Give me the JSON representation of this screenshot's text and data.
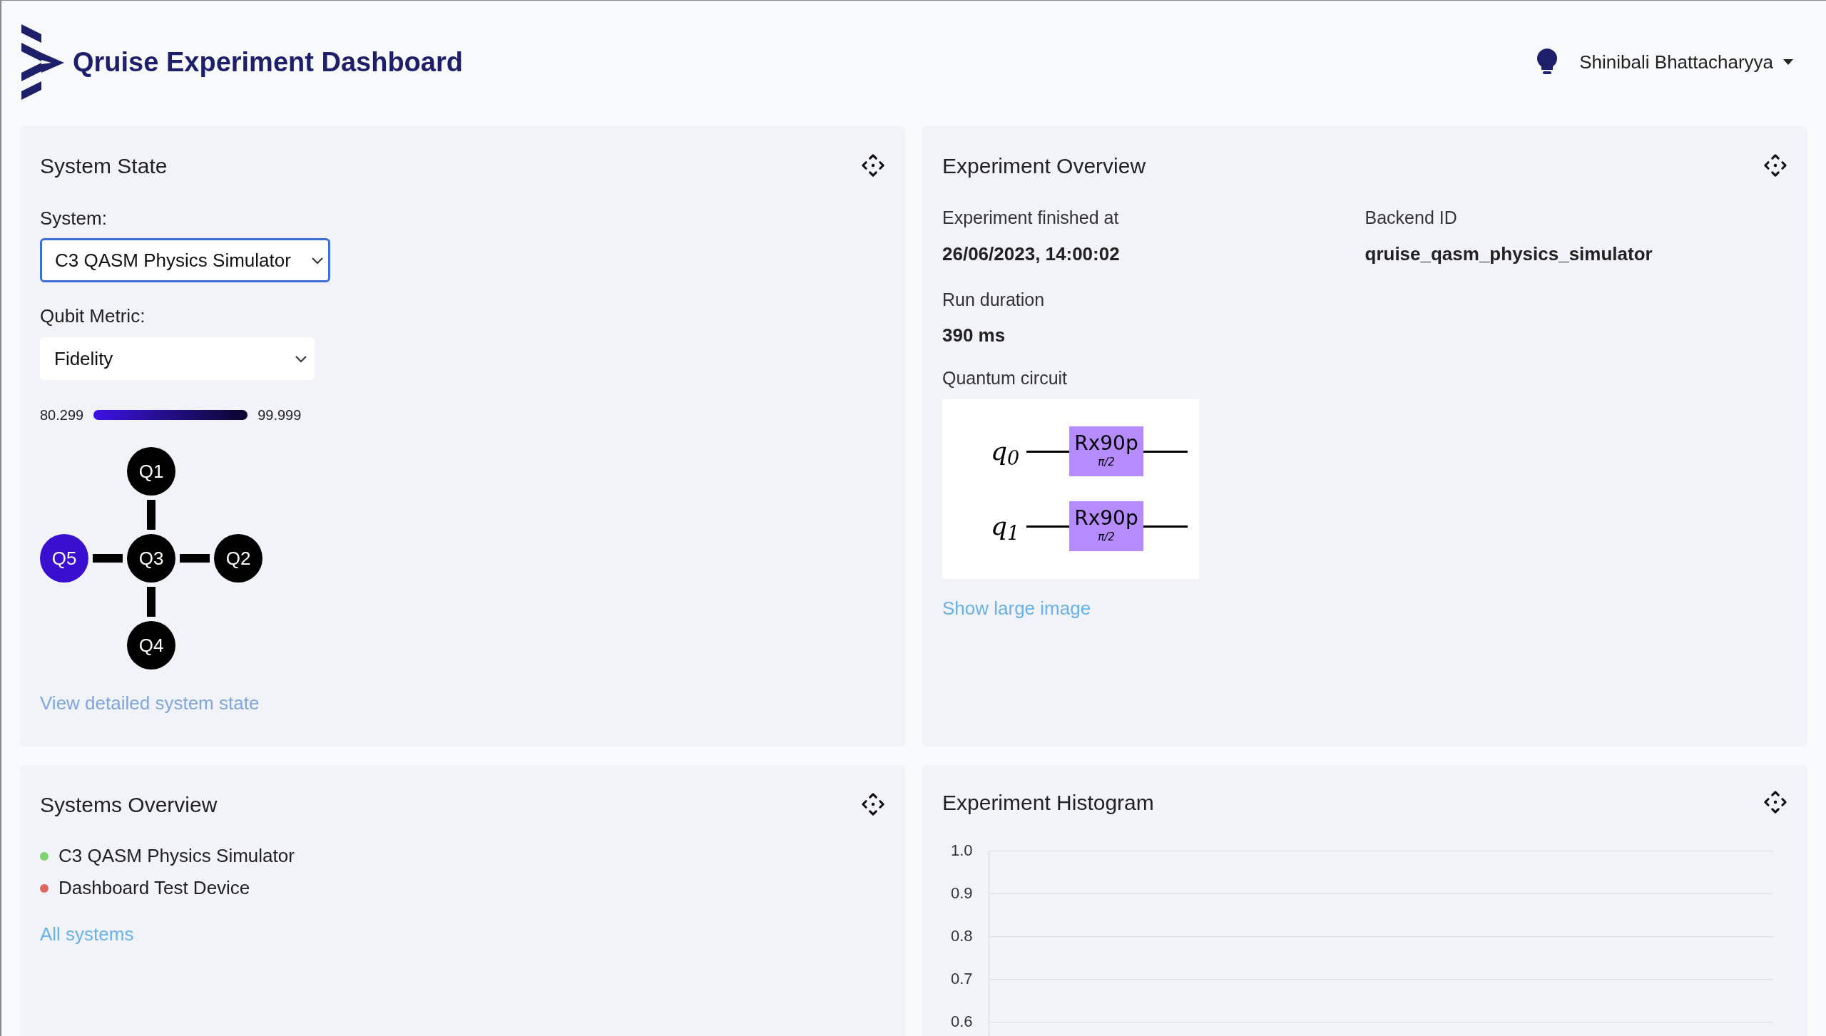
{
  "header": {
    "title": "Qruise Experiment Dashboard",
    "user": "Shinibali Bhattacharyya"
  },
  "system_state": {
    "title": "System State",
    "system_label": "System:",
    "system_value": "C3 QASM Physics Simulator",
    "system_focused": true,
    "metric_label": "Qubit Metric:",
    "metric_value": "Fidelity",
    "scale_min": "80.299",
    "scale_max": "99.999",
    "qubits": [
      {
        "label": "Q1",
        "color": "#000000"
      },
      {
        "label": "Q5",
        "color": "#3a0fd0"
      },
      {
        "label": "Q3",
        "color": "#000000"
      },
      {
        "label": "Q2",
        "color": "#000000"
      },
      {
        "label": "Q4",
        "color": "#000000"
      }
    ],
    "link": "View detailed system state"
  },
  "experiment_overview": {
    "title": "Experiment Overview",
    "fields": [
      {
        "label": "Experiment finished at",
        "value": "26/06/2023, 14:00:02"
      },
      {
        "label": "Backend ID",
        "value": "qruise_qasm_physics_simulator"
      },
      {
        "label": "Run duration",
        "value": "390 ms"
      }
    ],
    "circuit_label": "Quantum circuit",
    "circuit": [
      {
        "wire": "q$_{0}$",
        "gate": "Rx90p",
        "param": "π/2"
      },
      {
        "wire": "q$_{1}$",
        "gate": "Rx90p",
        "param": "π/2"
      }
    ],
    "link": "Show large image"
  },
  "systems_overview": {
    "title": "Systems Overview",
    "systems": [
      {
        "name": "C3 QASM Physics Simulator",
        "color": "#7ed36f"
      },
      {
        "name": "Dashboard Test Device",
        "color": "#e0675f"
      }
    ],
    "link": "All systems"
  },
  "experiment_histogram": {
    "title": "Experiment Histogram",
    "y_axis_labels": [
      "1.0",
      "0.9",
      "0.8",
      "0.7",
      "0.6"
    ]
  }
}
